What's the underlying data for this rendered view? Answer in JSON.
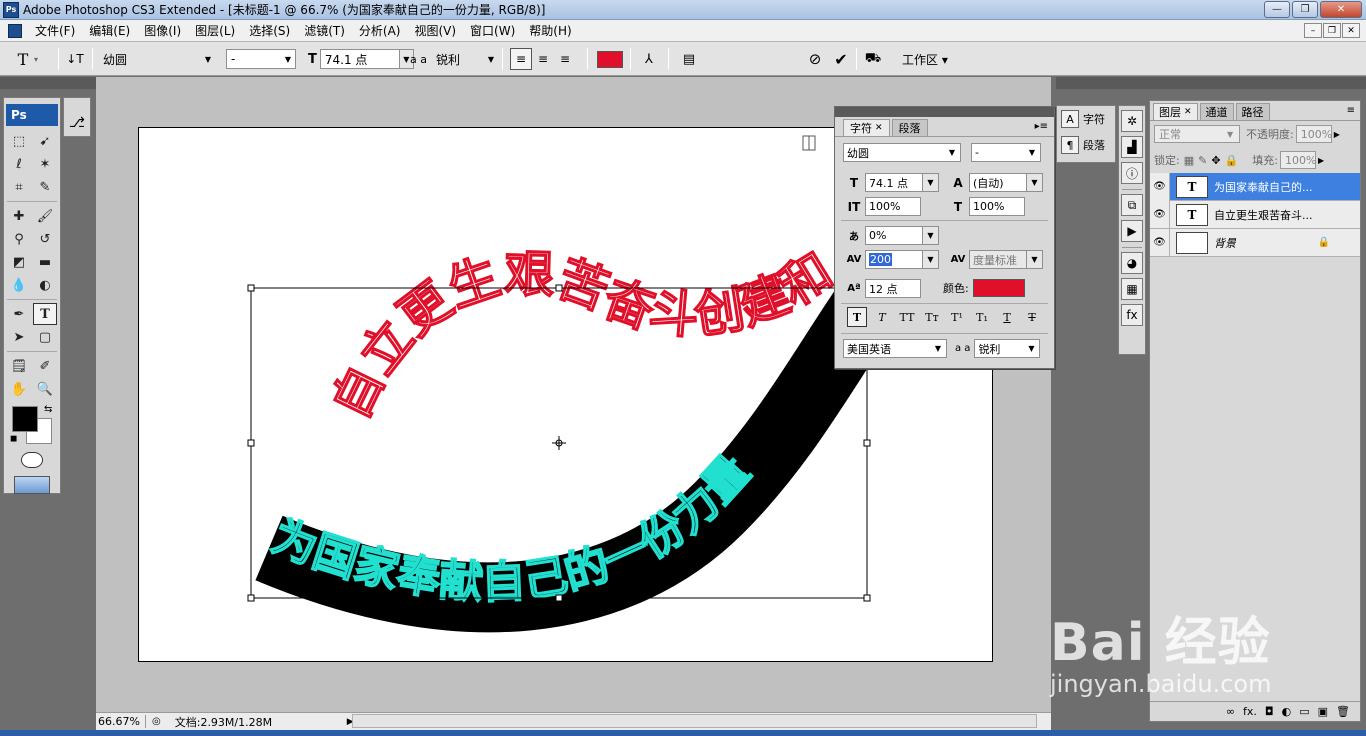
{
  "window": {
    "title": "Adobe Photoshop CS3 Extended - [未标题-1 @ 66.7% (为国家奉献自己的一份力量, RGB/8)]",
    "app_badge": "Ps",
    "buttons": [
      "—",
      "❐",
      "✕"
    ]
  },
  "menu": {
    "items": [
      "文件(F)",
      "编辑(E)",
      "图像(I)",
      "图层(L)",
      "选择(S)",
      "滤镜(T)",
      "分析(A)",
      "视图(V)",
      "窗口(W)",
      "帮助(H)"
    ]
  },
  "options_bar": {
    "font_family": "幼圆",
    "font_style": "-",
    "font_size": "74.1 点",
    "antialias_icon": "a a",
    "antialias": "锐利",
    "text_color": "#e0102a",
    "workspace_label": "工作区 ▾"
  },
  "toolbox": {
    "logo": "Ps",
    "fg_color": "#000000",
    "bg_color": "#ffffff"
  },
  "canvas": {
    "text_red": "自立更生艰苦奋斗创建和谐家园",
    "text_cyan": "为国家奉献自己的一份力量",
    "red_color": "#e0102a",
    "cyan_color": "#22e0d0"
  },
  "status": {
    "zoom": "66.67%",
    "doc_info": "文档:2.93M/1.28M"
  },
  "character_panel": {
    "tabs": [
      "字符",
      "段落"
    ],
    "font_family": "幼圆",
    "font_style": "-",
    "font_size": "74.1 点",
    "leading": "(自动)",
    "vertical_scale": "100%",
    "horizontal_scale": "100%",
    "tsume": "0%",
    "tracking": "200",
    "kerning": "度量标准",
    "baseline_shift": "12 点",
    "color_label": "颜色:",
    "color": "#e0102a",
    "style_buttons": [
      "T",
      "T",
      "TT",
      "Tт",
      "T¹",
      "T₁",
      "T",
      "T"
    ],
    "language": "美国英语",
    "antialias_icon": "a a",
    "antialias": "锐利"
  },
  "dock": {
    "character_label": "字符",
    "paragraph_label": "段落"
  },
  "layers_panel": {
    "tabs": [
      "图层",
      "通道",
      "路径"
    ],
    "blend_mode": "正常",
    "opacity_label": "不透明度:",
    "opacity": "100%",
    "lock_label": "锁定:",
    "fill_label": "填充:",
    "fill": "100%",
    "layers": [
      {
        "name": "为国家奉献自己的...",
        "type": "text",
        "selected": true
      },
      {
        "name": "自立更生艰苦奋斗...",
        "type": "text",
        "selected": false
      },
      {
        "name": "背景",
        "type": "background",
        "selected": false
      }
    ],
    "footer_icons": [
      "∞",
      "fx.",
      "◘",
      "◐",
      "▭",
      "▣",
      "🗑"
    ]
  },
  "watermark": {
    "brand": "Bai 经验",
    "url": "jingyan.baidu.com"
  }
}
